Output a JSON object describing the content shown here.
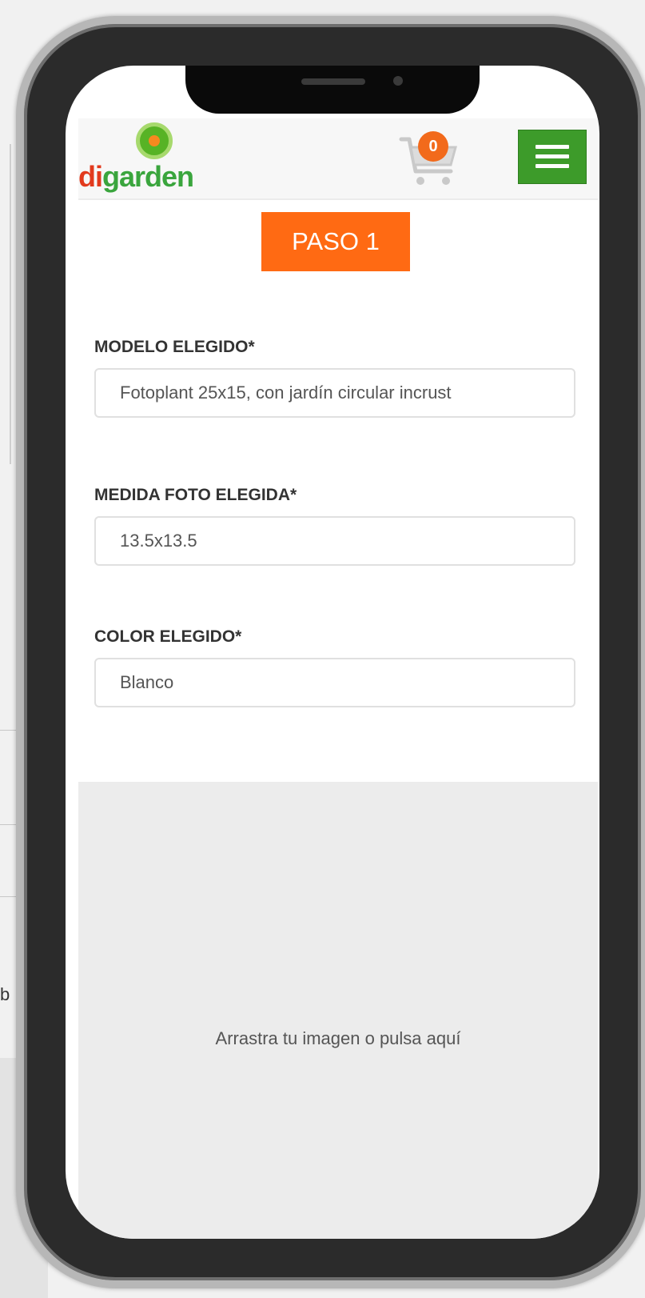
{
  "header": {
    "logo_text_part1": "di",
    "logo_text_part2": "garden",
    "cart_count": "0",
    "icons": [
      "logo-flower-icon",
      "cart-icon",
      "hamburger-menu-icon"
    ],
    "menu_color": "#3d9b2a"
  },
  "step": {
    "label": "PASO 1",
    "color": "#ff6a13"
  },
  "form": {
    "model": {
      "label": "MODELO ELEGIDO*",
      "value": "Fotoplant 25x15, con jardín circular incrust"
    },
    "photo_size": {
      "label": "MEDIDA FOTO ELEGIDA*",
      "value": "13.5x13.5"
    },
    "color": {
      "label": "COLOR ELEGIDO*",
      "value": "Blanco"
    }
  },
  "dropzone": {
    "text": "Arrastra tu imagen o pulsa aquí"
  },
  "background": {
    "fragment": "b"
  }
}
